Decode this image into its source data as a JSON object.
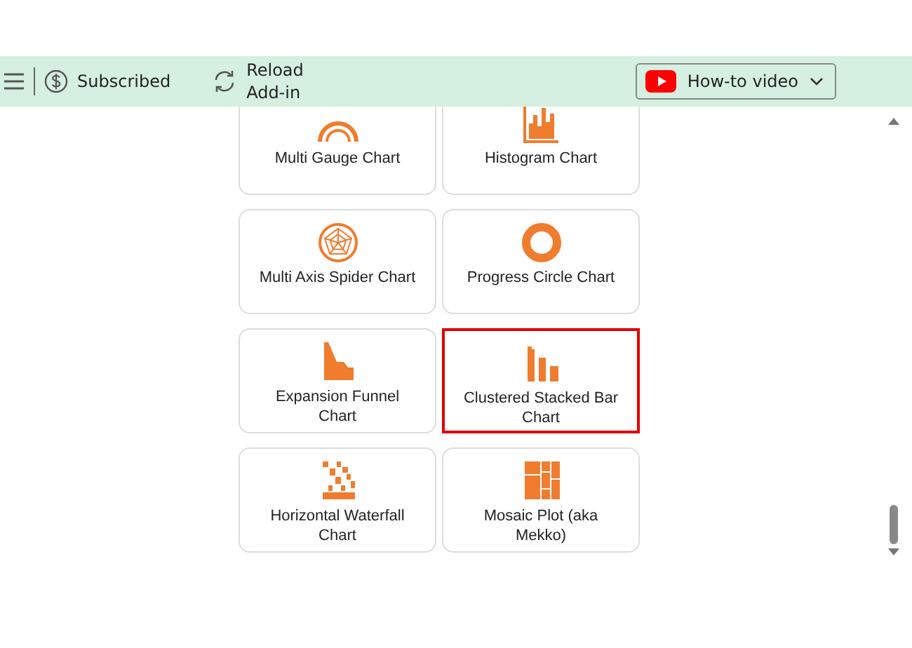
{
  "toolbar": {
    "subscription": "Subscribed",
    "reload": "Reload\nAdd-in",
    "video_button": "How-to video"
  },
  "cards": [
    {
      "kind": "gauge",
      "label": "Multi Gauge Chart",
      "selected": false
    },
    {
      "kind": "histogram",
      "label": "Histogram Chart",
      "selected": false
    },
    {
      "kind": "spider",
      "label": "Multi Axis Spider Chart",
      "selected": false
    },
    {
      "kind": "ring",
      "label": "Progress Circle Chart",
      "selected": false
    },
    {
      "kind": "funnel",
      "label": "Expansion Funnel\nChart",
      "selected": false
    },
    {
      "kind": "clustered",
      "label": "Clustered Stacked Bar\nChart",
      "selected": true
    },
    {
      "kind": "waterfall",
      "label": "Horizontal Waterfall\nChart",
      "selected": false
    },
    {
      "kind": "mosaic",
      "label": "Mosaic Plot (aka\nMekko)",
      "selected": false
    }
  ]
}
